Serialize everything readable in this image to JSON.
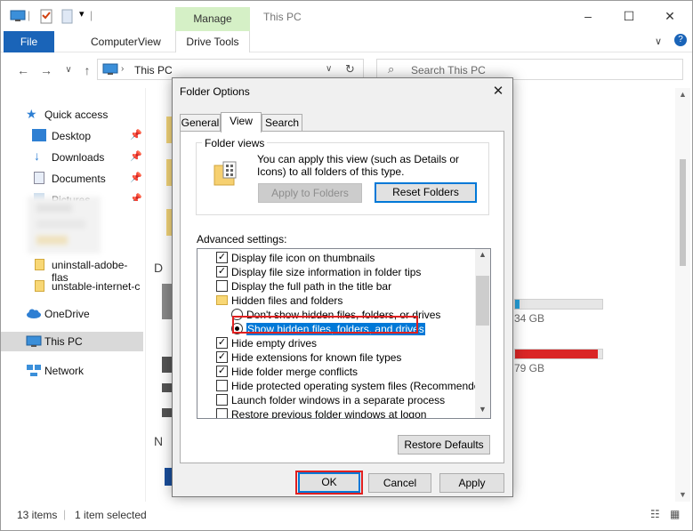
{
  "explorer": {
    "title": "This PC",
    "manage_tab": "Manage",
    "ribbon_tabs": [
      "File",
      "Computer",
      "View",
      "Drive Tools"
    ],
    "address": "This PC",
    "search_placeholder": "Search This PC",
    "sidebar": {
      "items": [
        {
          "label": "Quick access"
        },
        {
          "label": "Desktop"
        },
        {
          "label": "Downloads"
        },
        {
          "label": "Documents"
        },
        {
          "label": "Pictures"
        },
        {
          "label": "uninstall-adobe-flas"
        },
        {
          "label": "unstable-internet-c"
        },
        {
          "label": "OneDrive"
        },
        {
          "label": "This PC"
        },
        {
          "label": "Network"
        }
      ]
    },
    "drives": {
      "d_letter": "D",
      "n_letter": "N",
      "drive1_free": "34 GB",
      "drive1_fill": 0.05,
      "drive2_free": "79 GB",
      "drive2_fill": 0.95,
      "drive2_color": "#da2626"
    },
    "status": {
      "count": "13 items",
      "selected": "1 item selected"
    }
  },
  "dialog": {
    "title": "Folder Options",
    "tabs": [
      "General",
      "View",
      "Search"
    ],
    "folder_views": {
      "title": "Folder views",
      "description": "You can apply this view (such as Details or Icons) to all folders of this type.",
      "apply_button": "Apply to Folders",
      "reset_button": "Reset Folders"
    },
    "advanced_label": "Advanced settings:",
    "settings": [
      {
        "type": "checkbox",
        "label": "Display file icon on thumbnails",
        "checked": true
      },
      {
        "type": "checkbox",
        "label": "Display file size information in folder tips",
        "checked": true
      },
      {
        "type": "checkbox",
        "label": "Display the full path in the title bar",
        "checked": false
      },
      {
        "type": "folder",
        "label": "Hidden files and folders"
      },
      {
        "type": "radio",
        "label": "Don't show hidden files, folders, or drives",
        "checked": false
      },
      {
        "type": "radio",
        "label": "Show hidden files, folders, and drives",
        "checked": true,
        "selected": true
      },
      {
        "type": "checkbox",
        "label": "Hide empty drives",
        "checked": true
      },
      {
        "type": "checkbox",
        "label": "Hide extensions for known file types",
        "checked": true
      },
      {
        "type": "checkbox",
        "label": "Hide folder merge conflicts",
        "checked": true
      },
      {
        "type": "checkbox",
        "label": "Hide protected operating system files (Recommended)",
        "checked": false
      },
      {
        "type": "checkbox",
        "label": "Launch folder windows in a separate process",
        "checked": false
      },
      {
        "type": "checkbox",
        "label": "Restore previous folder windows at logon",
        "checked": false
      }
    ],
    "restore_defaults": "Restore Defaults",
    "ok": "OK",
    "cancel": "Cancel",
    "apply": "Apply"
  },
  "colors": {
    "accent": "#1a64b8",
    "highlight": "#0078d7",
    "annotation": "#e02020"
  }
}
